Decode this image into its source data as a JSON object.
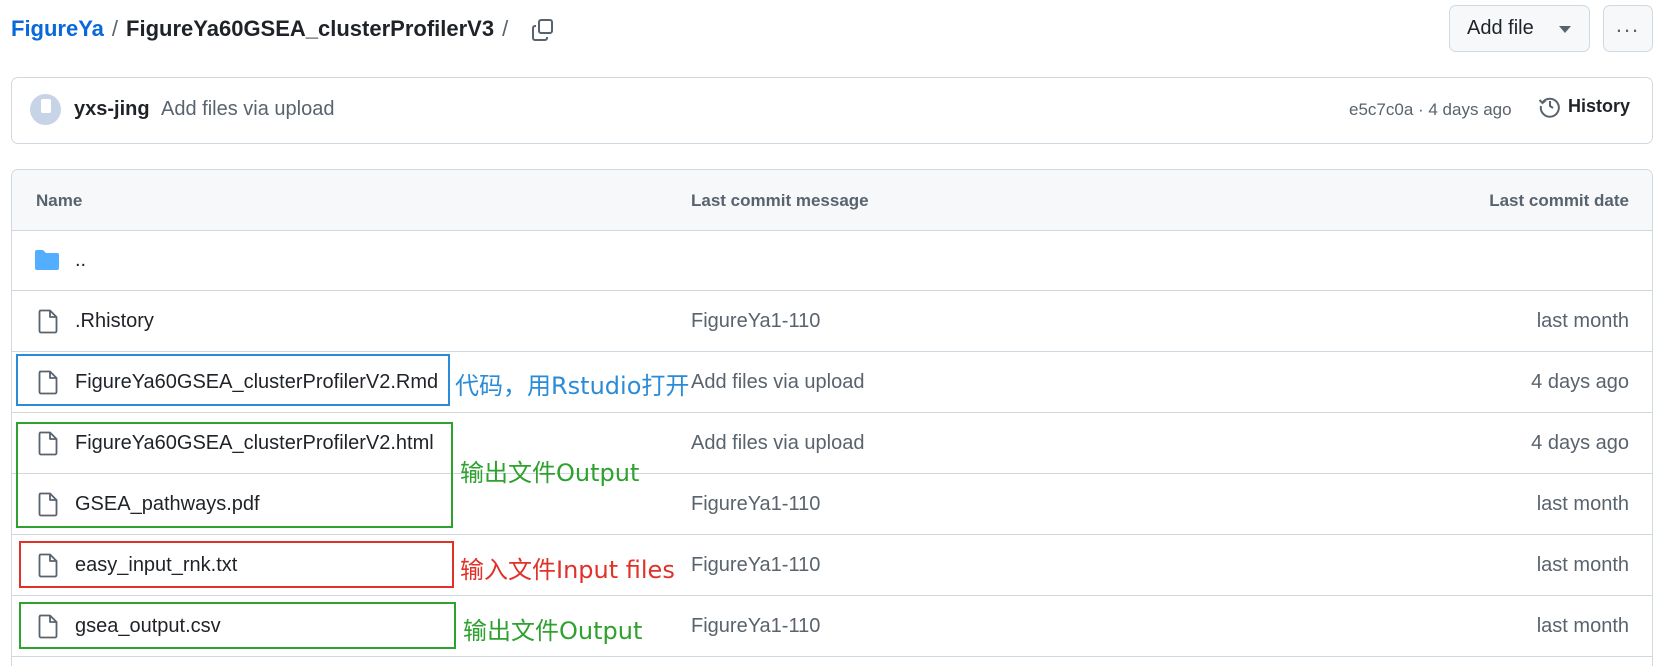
{
  "breadcrumb": {
    "root": "FigureYa",
    "sep1": "/",
    "current": "FigureYa60GSEA_clusterProfilerV3",
    "sep2": "/"
  },
  "header": {
    "add_file_label": "Add file",
    "more_label": "...",
    "icons": {
      "copy": "copy-icon",
      "caret": "triangle-down-icon",
      "more": "kebab-horizontal-icon"
    }
  },
  "commit": {
    "author": "yxs-jing",
    "message": "Add files via upload",
    "hash_time": "e5c7c0a · 4 days ago",
    "history_label": "History"
  },
  "table": {
    "headers": {
      "name": "Name",
      "message": "Last commit message",
      "date": "Last commit date"
    },
    "parent": "..",
    "rows": [
      {
        "name": ".Rhistory",
        "message": "FigureYa1-110",
        "date": "last month"
      },
      {
        "name": "FigureYa60GSEA_clusterProfilerV2.Rmd",
        "message": "Add files via upload",
        "date": "4 days ago"
      },
      {
        "name": "FigureYa60GSEA_clusterProfilerV2.html",
        "message": "Add files via upload",
        "date": "4 days ago"
      },
      {
        "name": "GSEA_pathways.pdf",
        "message": "FigureYa1-110",
        "date": "last month"
      },
      {
        "name": "easy_input_rnk.txt",
        "message": "FigureYa1-110",
        "date": "last month"
      },
      {
        "name": "gsea_output.csv",
        "message": "FigureYa1-110",
        "date": "last month"
      }
    ]
  },
  "annotations": [
    {
      "label": "代码，用Rstudio打开",
      "color": "#2a8cd8"
    },
    {
      "label": "输出文件Output",
      "color": "#2ea12e"
    },
    {
      "label": "输入文件Input files",
      "color": "#e03228"
    },
    {
      "label": "输出文件Output",
      "color": "#2ea12e"
    }
  ],
  "colors": {
    "link": "#0969da",
    "folder": "#54aeff",
    "border": "#d1d9e0",
    "header_bg": "#f6f8fa"
  }
}
